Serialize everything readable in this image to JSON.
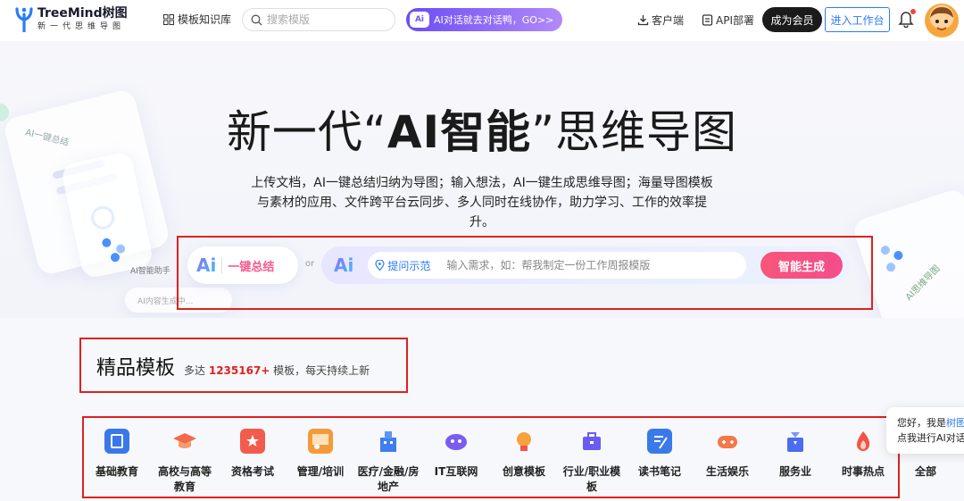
{
  "header": {
    "logo_name": "TreeMind",
    "logo_cn": "树图",
    "logo_slogan": "新一代思维导图",
    "nav_templates": "模板知识库",
    "search_placeholder": "搜索模版",
    "ai_banner": "AI对话就去对话鸭，GO>>",
    "ai_banner_icon": "Ai",
    "client": "客户端",
    "api": "API部署",
    "vip": "成为会员",
    "workspace": "进入工作台"
  },
  "hero": {
    "title_pre": "新一代“",
    "title_ai": "AI智能",
    "title_post": "”思维导图",
    "desc": "上传文档，AI一键总结归纳为导图；输入想法，AI一键生成思维导图；海量导图模板与素材的应用、文件跨平台云同步、多人同时在线协作，助力学习、工作的效率提升。",
    "summary_icon": "Ai",
    "summary_label": "一键总结",
    "or": "or",
    "gen_icon": "Ai",
    "tip_label": "提问示范",
    "gen_placeholder": "输入需求，如：帮我制定一份工作周报模版",
    "gen_button": "智能生成",
    "deco_left_1": "AI一键总结",
    "deco_left_2": "AI智能助手",
    "deco_left_3": "AI内容生成中...",
    "deco_right": "AI思维导图"
  },
  "templates": {
    "title": "精品模板",
    "sub_pre": "多达 ",
    "count": "1235167+",
    "sub_post": " 模板，每天持续上新"
  },
  "categories": [
    {
      "label": "基础教育",
      "icon": "book-icon",
      "color": "#3a78e8"
    },
    {
      "label": "高校与高等教育",
      "icon": "graduation-cap-icon",
      "color": "#f36a4a"
    },
    {
      "label": "资格考试",
      "icon": "certificate-icon",
      "color": "#f25c4c"
    },
    {
      "label": "管理/培训",
      "icon": "presentation-icon",
      "color": "#f59a3a"
    },
    {
      "label": "医疗/金融/房地产",
      "icon": "building-icon",
      "color": "#3f7ef0"
    },
    {
      "label": "IT互联网",
      "icon": "robot-icon",
      "color": "#7a5cf0"
    },
    {
      "label": "创意模板",
      "icon": "lightbulb-icon",
      "color": "#f7a23a"
    },
    {
      "label": "行业/职业模板",
      "icon": "briefcase-icon",
      "color": "#6a5cf0"
    },
    {
      "label": "读书笔记",
      "icon": "notebook-icon",
      "color": "#3a7ae8"
    },
    {
      "label": "生活娱乐",
      "icon": "gamepad-icon",
      "color": "#f5784a"
    },
    {
      "label": "服务业",
      "icon": "service-icon",
      "color": "#4a6cf0"
    },
    {
      "label": "时事热点",
      "icon": "flame-icon",
      "color": "#f2544a"
    },
    {
      "label": "全部",
      "icon": "",
      "color": ""
    }
  ],
  "chat": {
    "line1_pre": "您好，我是",
    "line1_name": "树图",
    "line2": "点我进行AI对话"
  }
}
